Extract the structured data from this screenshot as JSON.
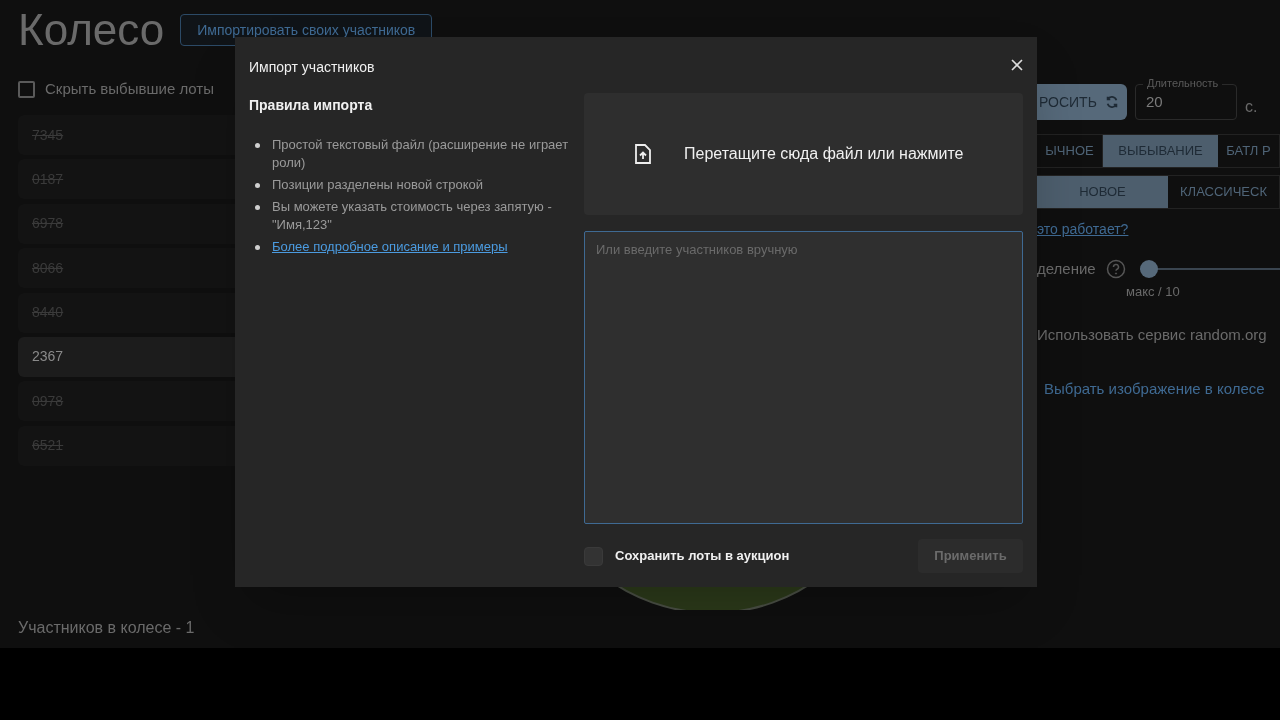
{
  "page": {
    "title": "Колесо",
    "import_button": "Импортировать своих участников",
    "hide_eliminated": {
      "label": "Скрыть выбывшие лоты",
      "checked": false
    },
    "lots": [
      {
        "name": "7345",
        "eliminated": true
      },
      {
        "name": "0187",
        "eliminated": true
      },
      {
        "name": "6978",
        "eliminated": true
      },
      {
        "name": "8066",
        "eliminated": true
      },
      {
        "name": "8440",
        "eliminated": true
      },
      {
        "name": "2367",
        "eliminated": false
      },
      {
        "name": "0978",
        "eliminated": true
      },
      {
        "name": "6521",
        "eliminated": true
      }
    ],
    "participants_count": "Участников в колесе - 1"
  },
  "settings": {
    "reset_button": "РОСИТЬ",
    "duration": {
      "label": "Длительность",
      "value": "20",
      "unit": "с."
    },
    "mode_tabs": [
      {
        "label": "ЫЧНОЕ",
        "selected": false
      },
      {
        "label": "ВЫБЫВАНИЕ",
        "selected": true
      },
      {
        "label": "БАТЛ Р",
        "selected": false
      }
    ],
    "style_tabs": [
      {
        "label": "НОВОЕ",
        "selected": true
      },
      {
        "label": "КЛАССИЧЕСК",
        "selected": false
      }
    ],
    "help_link": "это работает?",
    "split": {
      "label": "деление",
      "level": 0,
      "caption": "макс / 10"
    },
    "random_org": "Использовать сервис random.org",
    "image_link": "Выбрать изображение в колесе"
  },
  "modal": {
    "title": "Импорт участников",
    "rules_title": "Правила импорта",
    "rules": [
      {
        "kind": "text",
        "text": "Простой текстовый файл (расширение не играет роли)"
      },
      {
        "kind": "text",
        "text": "Позиции разделены новой строкой"
      },
      {
        "kind": "text",
        "text": "Вы можете указать стоимость через запятую - \"Имя,123\""
      },
      {
        "kind": "link",
        "text": "Более подробное описание и примеры"
      }
    ],
    "dropzone": "Перетащите сюда файл или нажмите",
    "textarea": {
      "placeholder": "Или введите участников вручную"
    },
    "save_lots": {
      "label": "Сохранить лоты в аукцион",
      "checked": false
    },
    "apply_button": {
      "label": "Применить",
      "disabled": true
    }
  }
}
